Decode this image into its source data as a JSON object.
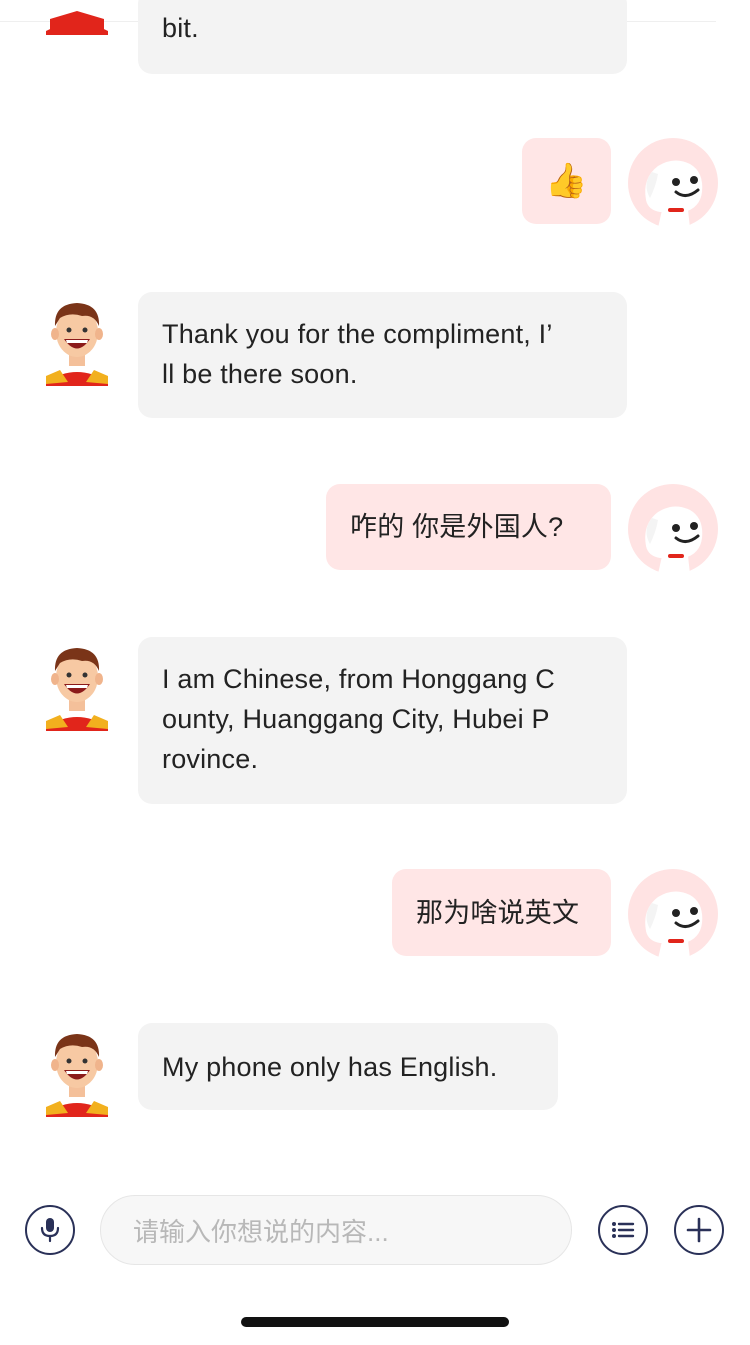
{
  "messages": [
    {
      "sender": "agent",
      "text": "bit."
    },
    {
      "sender": "user",
      "text": "👍"
    },
    {
      "sender": "agent",
      "text": "Thank you for the compliment, I’ll be there soon."
    },
    {
      "sender": "user",
      "text": "咋的 你是外国人?"
    },
    {
      "sender": "agent",
      "text": "I am Chinese, from Honggang County, Huanggang City, Hubei Province."
    },
    {
      "sender": "user",
      "text": "那为啥说英文"
    },
    {
      "sender": "agent",
      "text": "My phone only has English."
    }
  ],
  "lines": {
    "m0": [
      "bit."
    ],
    "m2": [
      "Thank you for the compliment, I’",
      "ll be there soon."
    ],
    "m4": [
      "I am Chinese, from Honggang C",
      "ounty, Huanggang City, Hubei P",
      "rovince."
    ],
    "m6": [
      "My phone only has English."
    ]
  },
  "input_bar": {
    "placeholder": "请输入你想说的内容...",
    "icons": [
      "microphone-icon",
      "list-icon",
      "plus-icon"
    ]
  },
  "colors": {
    "agent_bubble": "#f3f3f3",
    "user_bubble": "#ffe6e6",
    "icon_stroke": "#2a3158",
    "placeholder": "#b8b8b8",
    "brand_red": "#e1251b"
  }
}
